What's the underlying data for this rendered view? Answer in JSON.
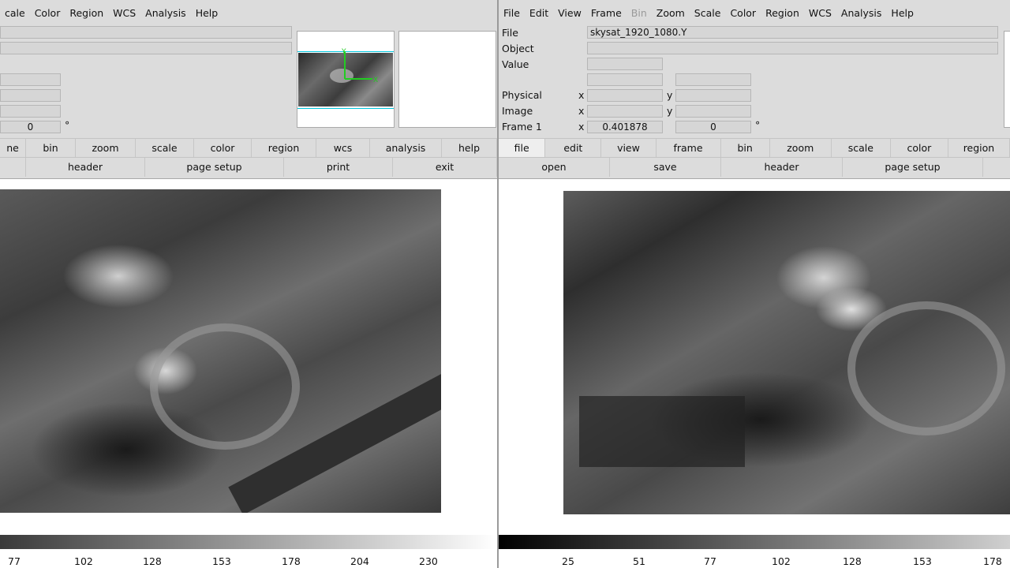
{
  "left": {
    "menu": [
      "cale",
      "Color",
      "Region",
      "WCS",
      "Analysis",
      "Help"
    ],
    "angle_value": "0",
    "degree": "°",
    "buttons1": [
      "ne",
      "bin",
      "zoom",
      "scale",
      "color",
      "region",
      "wcs",
      "analysis",
      "help"
    ],
    "buttons2": [
      "header",
      "page setup",
      "print",
      "exit"
    ],
    "colorbar_ticks": [
      "77",
      "102",
      "128",
      "153",
      "178",
      "204",
      "230"
    ]
  },
  "right": {
    "menu": [
      "File",
      "Edit",
      "View",
      "Frame",
      "Bin",
      "Zoom",
      "Scale",
      "Color",
      "Region",
      "WCS",
      "Analysis",
      "Help"
    ],
    "menu_disabled": "Bin",
    "labels": {
      "file": "File",
      "object": "Object",
      "value": "Value",
      "physical": "Physical",
      "image": "Image",
      "frame": "Frame 1",
      "x": "x",
      "y": "y",
      "degree": "°"
    },
    "file_value": "skysat_1920_1080.Y",
    "frame_x_value": "0.401878",
    "frame_y_value": "0",
    "buttons1": [
      "file",
      "edit",
      "view",
      "frame",
      "bin",
      "zoom",
      "scale",
      "color",
      "region"
    ],
    "active_button": "file",
    "buttons2": [
      "open",
      "save",
      "header",
      "page setup"
    ],
    "colorbar_ticks": [
      "25",
      "51",
      "77",
      "102",
      "128",
      "153",
      "178"
    ]
  },
  "colors": {
    "bg": "#dcdcdc",
    "field": "#d6d6d6",
    "canvas": "#ffffff",
    "pan_cursor": "#22cc22",
    "cyan": "#00c8e0"
  }
}
